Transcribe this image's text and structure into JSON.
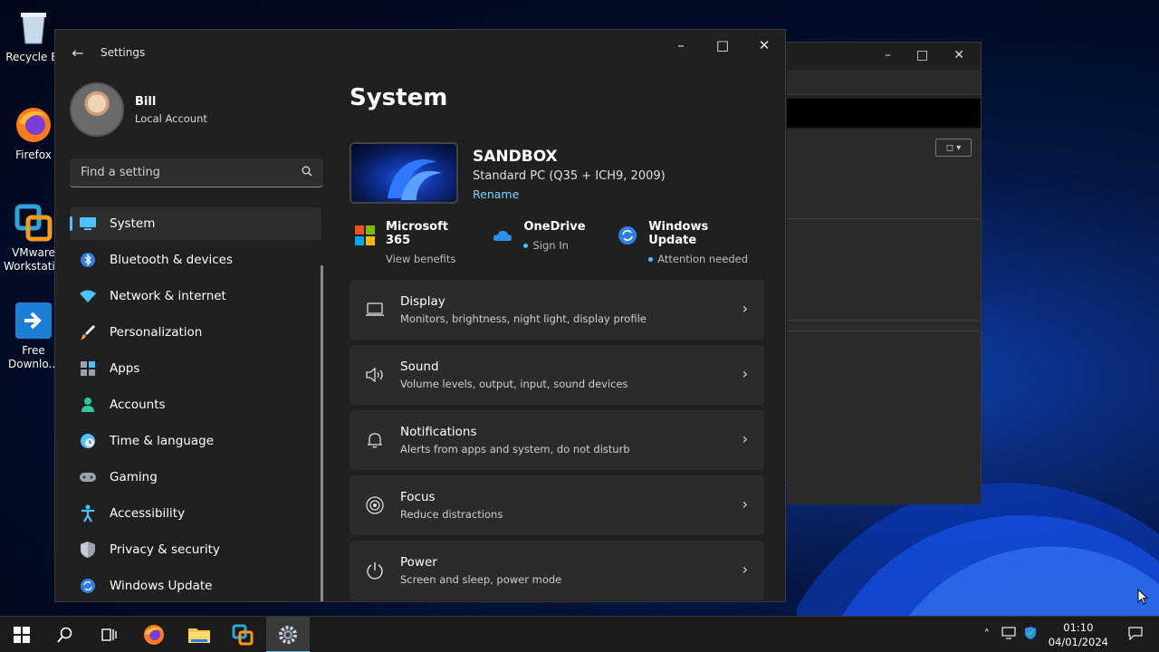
{
  "desktop": {
    "icons": [
      {
        "label": "Recycle Bi",
        "icon": "recycle-bin-icon"
      },
      {
        "label": "Firefox",
        "icon": "firefox-icon"
      },
      {
        "label": "VMware Workstati...",
        "icon": "vmware-icon"
      },
      {
        "label": "Free Downlo...",
        "icon": "download-manager-icon"
      }
    ]
  },
  "settings": {
    "title": "Settings",
    "user": {
      "name": "Bill",
      "account_type": "Local Account"
    },
    "search_placeholder": "Find a setting",
    "nav": [
      {
        "label": "System",
        "icon": "monitor-icon",
        "selected": true
      },
      {
        "label": "Bluetooth & devices",
        "icon": "bluetooth-icon"
      },
      {
        "label": "Network & internet",
        "icon": "wifi-icon"
      },
      {
        "label": "Personalization",
        "icon": "brush-icon"
      },
      {
        "label": "Apps",
        "icon": "apps-icon"
      },
      {
        "label": "Accounts",
        "icon": "person-icon"
      },
      {
        "label": "Time & language",
        "icon": "globe-clock-icon"
      },
      {
        "label": "Gaming",
        "icon": "gamepad-icon"
      },
      {
        "label": "Accessibility",
        "icon": "accessibility-icon"
      },
      {
        "label": "Privacy & security",
        "icon": "shield-icon"
      },
      {
        "label": "Windows Update",
        "icon": "update-icon"
      }
    ],
    "main": {
      "heading": "System",
      "device": {
        "name": "SANDBOX",
        "model": "Standard PC (Q35 + ICH9, 2009)",
        "rename": "Rename"
      },
      "services": [
        {
          "title": "Microsoft 365",
          "status": "View benefits",
          "dot": false,
          "icon": "microsoft-logo-icon"
        },
        {
          "title": "OneDrive",
          "status": "Sign In",
          "dot": true,
          "icon": "cloud-icon"
        },
        {
          "title": "Windows Update",
          "status": "Attention needed",
          "dot": true,
          "icon": "update-icon"
        }
      ],
      "cards": [
        {
          "title": "Display",
          "subtitle": "Monitors, brightness, night light, display profile",
          "icon": "laptop-icon"
        },
        {
          "title": "Sound",
          "subtitle": "Volume levels, output, input, sound devices",
          "icon": "speaker-icon"
        },
        {
          "title": "Notifications",
          "subtitle": "Alerts from apps and system, do not disturb",
          "icon": "bell-icon"
        },
        {
          "title": "Focus",
          "subtitle": "Reduce distractions",
          "icon": "focus-icon"
        },
        {
          "title": "Power",
          "subtitle": "Screen and sleep, power mode",
          "icon": "power-icon"
        }
      ]
    }
  },
  "taskbar": {
    "clock_time": "01:10",
    "clock_date": "04/01/2024",
    "accent": "#4cc2ff"
  }
}
